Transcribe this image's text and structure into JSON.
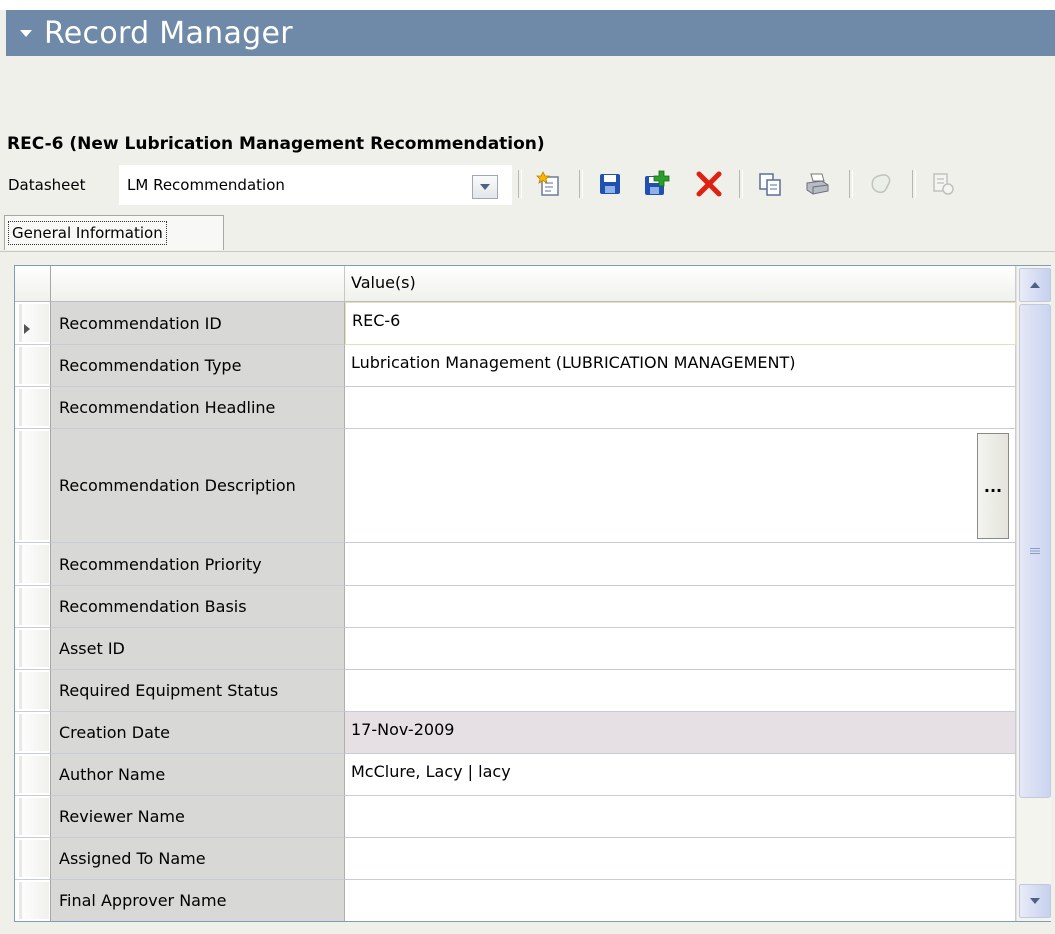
{
  "panel": {
    "title": "Record Manager"
  },
  "record": {
    "title": "REC-6 (New Lubrication Management Recommendation)"
  },
  "datasheet": {
    "label": "Datasheet",
    "selected": "LM Recommendation"
  },
  "toolbar": {
    "icons": [
      "new-record-icon",
      "save-icon",
      "save-and-add-icon",
      "delete-icon",
      "copy-icon",
      "print-icon",
      "link-icon",
      "report-icon"
    ],
    "disabled": [
      "link-icon",
      "report-icon"
    ]
  },
  "tabs": [
    {
      "label": "General Information",
      "active": true
    }
  ],
  "grid": {
    "header": {
      "value_col": "Value(s)"
    },
    "rows": [
      {
        "field": "Recommendation ID",
        "value": "REC-6"
      },
      {
        "field": "Recommendation Type",
        "value": "Lubrication Management (LUBRICATION MANAGEMENT)"
      },
      {
        "field": "Recommendation Headline",
        "value": ""
      },
      {
        "field": "Recommendation Description",
        "value": "",
        "ellipsis": "..."
      },
      {
        "field": "Recommendation Priority",
        "value": ""
      },
      {
        "field": "Recommendation Basis",
        "value": ""
      },
      {
        "field": "Asset ID",
        "value": ""
      },
      {
        "field": "Required Equipment Status",
        "value": ""
      },
      {
        "field": "Creation Date",
        "value": "17-Nov-2009"
      },
      {
        "field": "Author Name",
        "value": "McClure, Lacy | lacy"
      },
      {
        "field": "Reviewer Name",
        "value": ""
      },
      {
        "field": "Assigned To Name",
        "value": ""
      },
      {
        "field": "Final Approver Name",
        "value": ""
      }
    ]
  },
  "colors": {
    "header_bg": "#6f8aa8",
    "delete": "#e02010",
    "save": "#2050b0"
  }
}
